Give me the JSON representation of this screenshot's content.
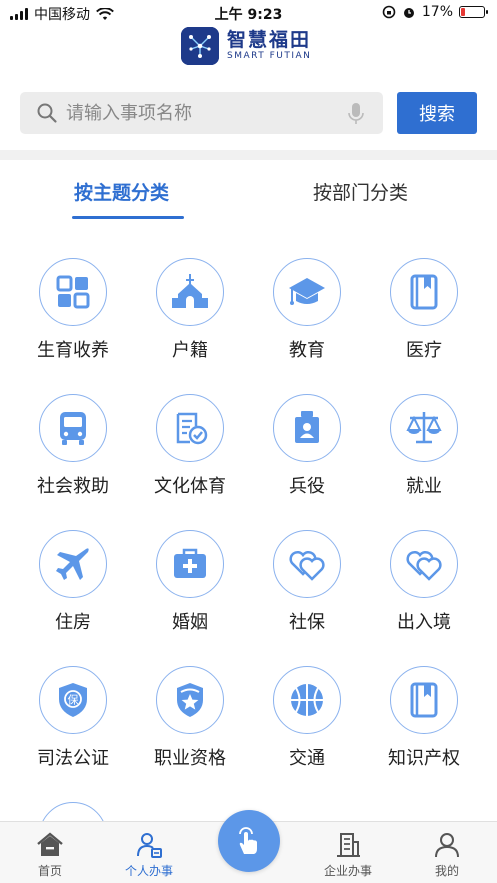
{
  "status_bar": {
    "carrier": "中国移动",
    "time": "上午 9:23",
    "battery_percent": "17%",
    "battery_level": 0.17,
    "battery_color": "#e53935"
  },
  "header": {
    "logo_cn": "智慧福田",
    "logo_en": "SMART FUTIAN"
  },
  "search": {
    "placeholder": "请输入事项名称",
    "button_label": "搜索"
  },
  "tabs": [
    {
      "label": "按主题分类",
      "active": true
    },
    {
      "label": "按部门分类",
      "active": false
    }
  ],
  "categories": [
    {
      "label": "生育收养",
      "icon": "grid-icon"
    },
    {
      "label": "户籍",
      "icon": "church-icon"
    },
    {
      "label": "教育",
      "icon": "graduation-cap-icon"
    },
    {
      "label": "医疗",
      "icon": "book-icon"
    },
    {
      "label": "社会救助",
      "icon": "bus-icon"
    },
    {
      "label": "文化体育",
      "icon": "document-check-icon"
    },
    {
      "label": "兵役",
      "icon": "id-badge-icon"
    },
    {
      "label": "就业",
      "icon": "scale-icon"
    },
    {
      "label": "住房",
      "icon": "airplane-icon"
    },
    {
      "label": "婚姻",
      "icon": "first-aid-kit-icon"
    },
    {
      "label": "社保",
      "icon": "hearts-icon"
    },
    {
      "label": "出入境",
      "icon": "hearts-icon"
    },
    {
      "label": "司法公证",
      "icon": "shield-bao-icon"
    },
    {
      "label": "职业资格",
      "icon": "star-badge-icon"
    },
    {
      "label": "交通",
      "icon": "basketball-icon"
    },
    {
      "label": "知识产权",
      "icon": "book-icon"
    }
  ],
  "bottom_nav": {
    "items": [
      {
        "label": "首页",
        "icon": "home-icon"
      },
      {
        "label": "个人办事",
        "icon": "person-icon",
        "active": true
      },
      {
        "label": "企业办事",
        "icon": "building-icon"
      },
      {
        "label": "我的",
        "icon": "profile-icon"
      }
    ],
    "fab_icon": "touch-hand-icon"
  },
  "colors": {
    "accent": "#2f6fd1",
    "icon_blue": "#5c97e8",
    "circle_border": "#8bb2ee"
  }
}
